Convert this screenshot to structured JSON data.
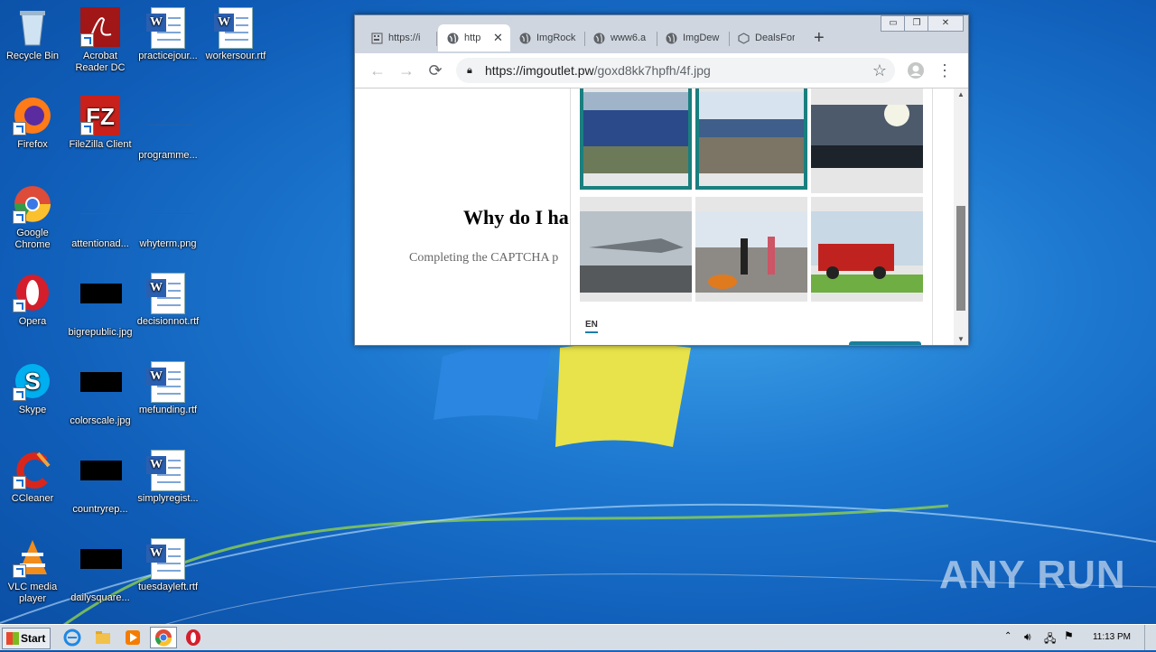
{
  "desktop": {
    "icons": [
      {
        "label": "Recycle Bin",
        "kind": "recycle-bin"
      },
      {
        "label": "Acrobat Reader DC",
        "kind": "acrobat"
      },
      {
        "label": "practicejour...",
        "kind": "word-doc"
      },
      {
        "label": "workersour.rtf",
        "kind": "word-doc"
      },
      {
        "label": "Firefox",
        "kind": "firefox"
      },
      {
        "label": "FileZilla Client",
        "kind": "filezilla"
      },
      {
        "label": "programme...",
        "kind": "blank"
      },
      {
        "label": "Google Chrome",
        "kind": "chrome"
      },
      {
        "label": "attentionad...",
        "kind": "blank"
      },
      {
        "label": "whyterm.png",
        "kind": "blank"
      },
      {
        "label": "Opera",
        "kind": "opera"
      },
      {
        "label": "bigrepublic.jpg",
        "kind": "black"
      },
      {
        "label": "decisionnot.rtf",
        "kind": "word-doc"
      },
      {
        "label": "Skype",
        "kind": "skype"
      },
      {
        "label": "colorscale.jpg",
        "kind": "black"
      },
      {
        "label": "mefunding.rtf",
        "kind": "word-doc"
      },
      {
        "label": "CCleaner",
        "kind": "ccleaner"
      },
      {
        "label": "countryrep...",
        "kind": "black"
      },
      {
        "label": "simplyregist...",
        "kind": "word-doc"
      },
      {
        "label": "VLC media player",
        "kind": "vlc"
      },
      {
        "label": "dailysquare...",
        "kind": "black"
      },
      {
        "label": "tuesdayleft.rtf",
        "kind": "word-doc"
      }
    ]
  },
  "browser": {
    "tabs": [
      {
        "title": "https://i",
        "icon": "page-icon"
      },
      {
        "title": "http",
        "icon": "globe-icon",
        "active": true
      },
      {
        "title": "ImgRock",
        "icon": "globe-icon"
      },
      {
        "title": "www6.a",
        "icon": "globe-icon"
      },
      {
        "title": "ImgDew",
        "icon": "globe-icon"
      },
      {
        "title": "DealsFor",
        "icon": "cube-icon"
      }
    ],
    "new_tab": "+",
    "url_host": "https://imgoutlet.pw",
    "url_path": "/goxd8kk7hpfh/4f.jpg",
    "page": {
      "heading": "Why do I ha",
      "subtext": "Completing the CAPTCHA p"
    },
    "captcha": {
      "language": "EN",
      "tiles": [
        {
          "subject": "train side view",
          "selected": true
        },
        {
          "subject": "railway platform",
          "selected": true
        },
        {
          "subject": "sunset skyline",
          "selected": false
        },
        {
          "subject": "fighter jet on deck",
          "selected": false
        },
        {
          "subject": "motorcycles and crowd",
          "selected": false
        },
        {
          "subject": "red fire truck",
          "selected": false
        }
      ]
    }
  },
  "taskbar": {
    "start_label": "Start",
    "clock": "11:13 PM",
    "pinned": [
      "internet-explorer-icon",
      "explorer-icon",
      "media-player-icon",
      "chrome-icon",
      "opera-icon"
    ]
  },
  "watermark": "ANY RUN"
}
